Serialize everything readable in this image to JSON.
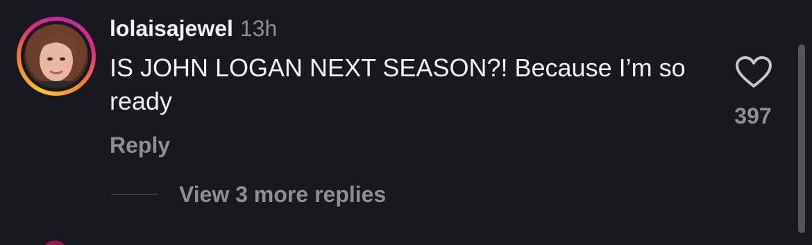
{
  "comment": {
    "username": "lolaisajewel",
    "timestamp": "13h",
    "text": "IS JOHN LOGAN NEXT SEASON?! Because I’m so ready",
    "reply_label": "Reply",
    "view_replies_label": "View 3 more replies",
    "like_count": "397"
  },
  "colors": {
    "background": "#18191e",
    "primary_text": "#f2f2f2",
    "secondary_text": "#8e8e93",
    "story_ring": [
      "#f9c52b",
      "#f58529",
      "#dd2a7b",
      "#b42fa5"
    ]
  },
  "icons": {
    "like": "heart-outline-icon",
    "avatar": "user-avatar"
  }
}
